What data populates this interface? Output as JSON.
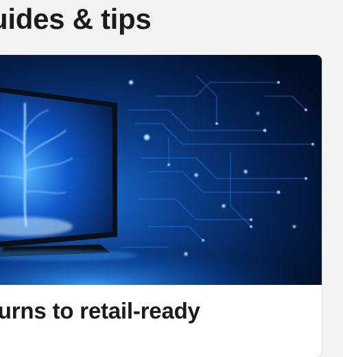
{
  "section": {
    "heading": "uides & tips"
  },
  "card": {
    "title": "turns to retail-ready",
    "description": "",
    "image_name": "tv-circuit-illustration"
  },
  "colors": {
    "background": "#f3f3f3",
    "card": "#ffffff",
    "text": "#1b1b1b",
    "image_glow": "#1e90ff",
    "image_dark": "#021634"
  }
}
